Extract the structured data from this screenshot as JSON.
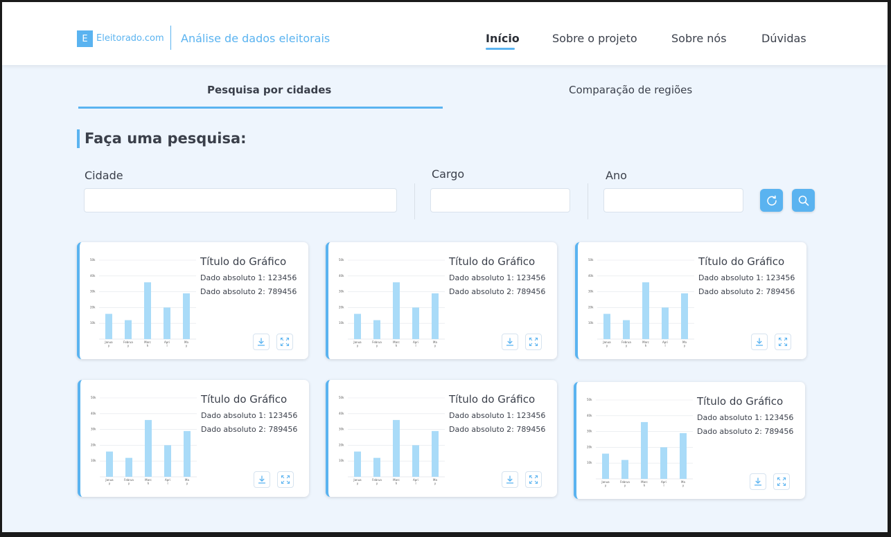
{
  "header": {
    "logo_letter": "E",
    "logo_text": "Eleitorado.com",
    "subtitle": "Análise de dados eleitorais",
    "nav": [
      "Início",
      "Sobre o projeto",
      "Sobre nós",
      "Dúvidas"
    ]
  },
  "tabs": [
    "Pesquisa por cidades",
    "Comparação de regiões"
  ],
  "search": {
    "title": "Faça uma pesquisa:",
    "fields": [
      {
        "label": "Cidade",
        "value": "",
        "placeholder": ""
      },
      {
        "label": "Cargo",
        "value": "",
        "placeholder": ""
      },
      {
        "label": "Ano",
        "value": "",
        "placeholder": ""
      }
    ],
    "refresh_icon": "refresh-icon",
    "search_icon": "search-icon"
  },
  "cards": [
    {
      "title": "Título do Gráfico",
      "stat1": "Dado absoluto 1: 123456",
      "stat2": "Dado absoluto 2: 789456"
    },
    {
      "title": "Título do Gráfico",
      "stat1": "Dado absoluto 1: 123456",
      "stat2": "Dado absoluto 2: 789456"
    },
    {
      "title": "Título do Gráfico",
      "stat1": "Dado absoluto 1: 123456",
      "stat2": "Dado absoluto 2: 789456"
    },
    {
      "title": "Título do Gráfico",
      "stat1": "Dado absoluto 1: 123456",
      "stat2": "Dado absoluto 2: 789456"
    },
    {
      "title": "Título do Gráfico",
      "stat1": "Dado absoluto 1: 123456",
      "stat2": "Dado absoluto 2: 789456"
    },
    {
      "title": "Título do Gráfico",
      "stat1": "Dado absoluto 1: 123456",
      "stat2": "Dado absoluto 2: 789456"
    }
  ],
  "chart_data": {
    "type": "bar",
    "categories": [
      "Janua\ny",
      "Februa\ny",
      "Marc\nh",
      "Apri\nl",
      "Ma\ny"
    ],
    "values": [
      16,
      12,
      36,
      20,
      29
    ],
    "yticks": [
      "10k",
      "20k",
      "30k",
      "40k",
      "50k"
    ],
    "ylim": [
      0,
      50
    ],
    "bar_color": "#a9dbf8",
    "grid": true
  },
  "colors": {
    "accent": "#5ab3f0",
    "background": "#eef5fd",
    "text": "#3a3f4a"
  }
}
